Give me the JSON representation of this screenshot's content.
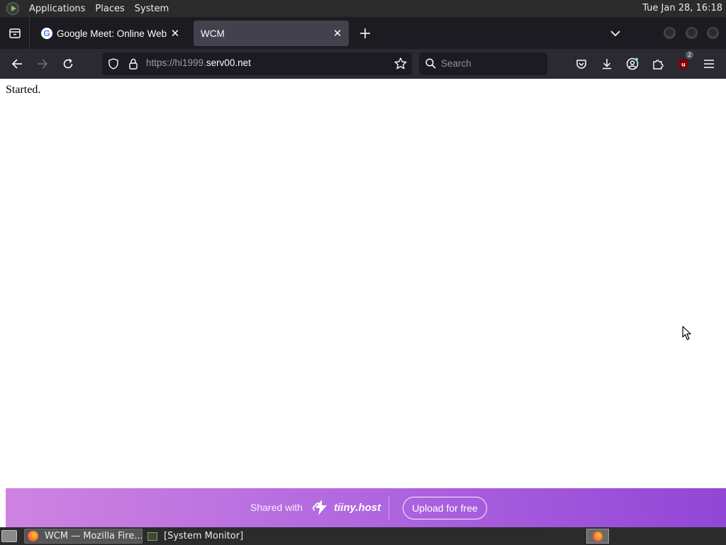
{
  "top_panel": {
    "menus": [
      "Applications",
      "Places",
      "System"
    ],
    "clock": "Tue Jan 28, 16:18"
  },
  "tabs": [
    {
      "title": "Google Meet: Online Web a",
      "favicon": "google-favicon",
      "active": false
    },
    {
      "title": "WCM",
      "favicon": "",
      "active": true
    }
  ],
  "navbar": {
    "url_prefix": "https://hi1999.",
    "url_host": "serv00.net",
    "search_placeholder": "Search",
    "extension_badge": "2"
  },
  "page": {
    "body_text": "Started."
  },
  "banner": {
    "shared_text": "Shared with",
    "brand": "tiiny.host",
    "upload_button": "Upload for free",
    "gradient_start": "#cf83e1",
    "gradient_end": "#9246d6"
  },
  "taskbar": {
    "tasks": [
      {
        "label": "WCM — Mozilla Fire...",
        "icon": "firefox-icon",
        "active": true
      },
      {
        "label": "[System Monitor]",
        "icon": "system-monitor-icon",
        "active": false
      }
    ]
  },
  "colors": {
    "panel_bg": "#2b2b2b",
    "tabstrip_bg": "#1c1b22",
    "toolbar_bg": "#2b2a33",
    "active_tab_bg": "#42414d"
  }
}
